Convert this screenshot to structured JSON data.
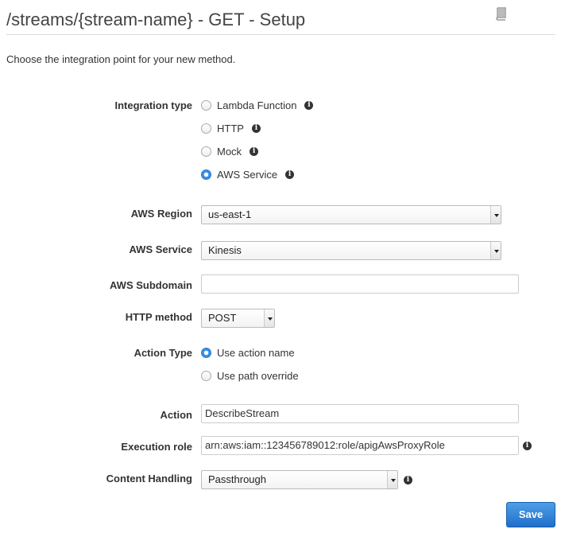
{
  "header": {
    "title": "/streams/{stream-name} - GET - Setup",
    "subtitle": "Choose the integration point for your new method."
  },
  "form": {
    "integration_type": {
      "label": "Integration type",
      "options": [
        "Lambda Function",
        "HTTP",
        "Mock",
        "AWS Service"
      ],
      "selected": "AWS Service"
    },
    "aws_region": {
      "label": "AWS Region",
      "value": "us-east-1"
    },
    "aws_service": {
      "label": "AWS Service",
      "value": "Kinesis"
    },
    "aws_subdomain": {
      "label": "AWS Subdomain",
      "value": ""
    },
    "http_method": {
      "label": "HTTP method",
      "value": "POST"
    },
    "action_type": {
      "label": "Action Type",
      "options": [
        "Use action name",
        "Use path override"
      ],
      "selected": "Use action name"
    },
    "action": {
      "label": "Action",
      "value": "DescribeStream"
    },
    "execution_role": {
      "label": "Execution role",
      "value": "arn:aws:iam::123456789012:role/apigAwsProxyRole"
    },
    "content_handling": {
      "label": "Content Handling",
      "value": "Passthrough"
    }
  },
  "buttons": {
    "save": "Save"
  },
  "icons": {
    "info": "info-icon",
    "book": "book-icon"
  },
  "colors": {
    "accent": "#2a7fd4",
    "save_button": "#2d7fd6"
  }
}
